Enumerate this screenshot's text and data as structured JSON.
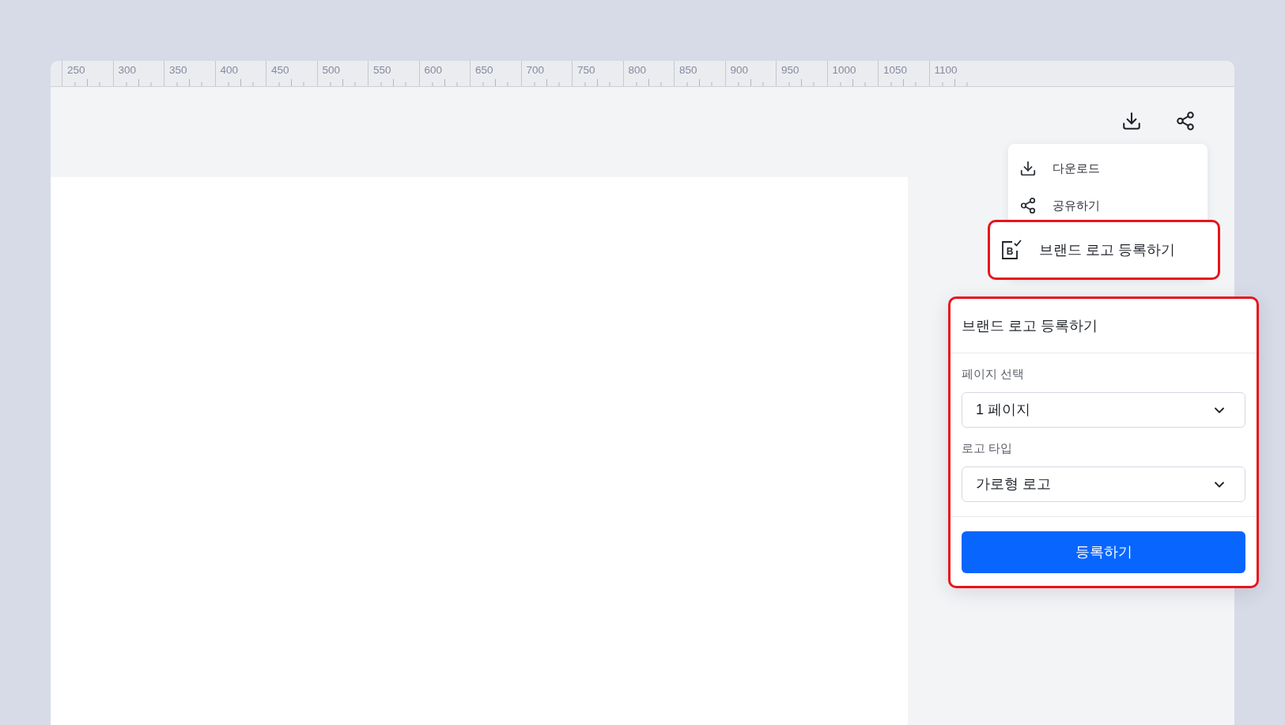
{
  "ruler": {
    "labels": [
      "250",
      "300",
      "350",
      "400",
      "450",
      "500",
      "550",
      "600",
      "650",
      "700",
      "750",
      "800",
      "850",
      "900",
      "950",
      "1000",
      "1050",
      "1100"
    ]
  },
  "menu": {
    "items": [
      {
        "label": "다운로드",
        "highlighted": false
      },
      {
        "label": "공유하기",
        "highlighted": false
      },
      {
        "label": "브랜드 로고 등록하기",
        "icon_letter": "B",
        "highlighted": true
      }
    ]
  },
  "panel": {
    "title": "브랜드 로고 등록하기",
    "highlighted": true,
    "fields": [
      {
        "label": "페이지 선택",
        "value": "1 페이지"
      },
      {
        "label": "로고 타입",
        "value": "가로형 로고"
      }
    ],
    "submit": "등록하기"
  }
}
